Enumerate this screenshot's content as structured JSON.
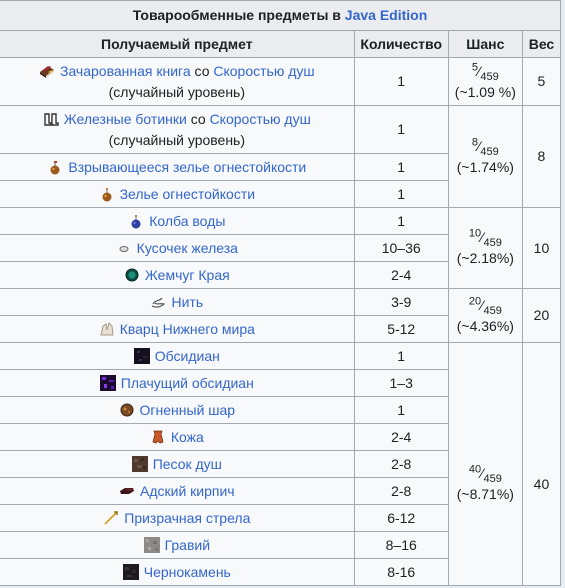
{
  "table": {
    "caption_prefix": "Товарообменные предметы в",
    "caption_link": "Java Edition",
    "headers": {
      "item": "Получаемый предмет",
      "quantity": "Количество",
      "chance": "Шанс",
      "weight": "Вес"
    },
    "groups": [
      {
        "chance_num": "5",
        "chance_den": "459",
        "chance_pct": "(~1.09 %)",
        "weight": "5"
      },
      {
        "chance_num": "8",
        "chance_den": "459",
        "chance_pct": "(~1.74%)",
        "weight": "8"
      },
      {
        "chance_num": "10",
        "chance_den": "459",
        "chance_pct": "(~2.18%)",
        "weight": "10"
      },
      {
        "chance_num": "20",
        "chance_den": "459",
        "chance_pct": "(~4.36%)",
        "weight": "20"
      },
      {
        "chance_num": "40",
        "chance_den": "459",
        "chance_pct": "(~8.71%)",
        "weight": "40"
      }
    ],
    "rows": [
      {
        "icon": "enchanted-book-icon",
        "name": "Зачарованная книга",
        "joiner": " со ",
        "name2": "Скоростью душ",
        "note": "(случайный уровень)",
        "qty": "1"
      },
      {
        "icon": "iron-boots-icon",
        "name": "Железные ботинки",
        "joiner": " со ",
        "name2": "Скоростью душ",
        "note": "(случайный уровень)",
        "qty": "1"
      },
      {
        "icon": "splash-potion-icon",
        "name": "Взрывающееся зелье огнестойкости",
        "qty": "1"
      },
      {
        "icon": "potion-icon",
        "name": "Зелье огнестойкости",
        "qty": "1"
      },
      {
        "icon": "water-bottle-icon",
        "name": "Колба воды",
        "qty": "1"
      },
      {
        "icon": "iron-nugget-icon",
        "name": "Кусочек железа",
        "qty": "10–36"
      },
      {
        "icon": "ender-pearl-icon",
        "name": "Жемчуг Края",
        "qty": "2-4"
      },
      {
        "icon": "string-icon",
        "name": "Нить",
        "qty": "3-9"
      },
      {
        "icon": "nether-quartz-icon",
        "name": "Кварц Нижнего мира",
        "qty": "5-12"
      },
      {
        "icon": "obsidian-icon",
        "name": "Обсидиан",
        "qty": "1"
      },
      {
        "icon": "crying-obsidian-icon",
        "name": "Плачущий обсидиан",
        "qty": "1–3"
      },
      {
        "icon": "fire-charge-icon",
        "name": "Огненный шар",
        "qty": "1"
      },
      {
        "icon": "leather-icon",
        "name": "Кожа",
        "qty": "2-4"
      },
      {
        "icon": "soul-sand-icon",
        "name": "Песок душ",
        "qty": "2-8"
      },
      {
        "icon": "nether-brick-icon",
        "name": "Адский кирпич",
        "qty": "2-8"
      },
      {
        "icon": "spectral-arrow-icon",
        "name": "Призрачная стрела",
        "qty": "6-12"
      },
      {
        "icon": "gravel-icon",
        "name": "Гравий",
        "qty": "8–16"
      },
      {
        "icon": "blackstone-icon",
        "name": "Чернокамень",
        "qty": "8-16"
      }
    ]
  }
}
